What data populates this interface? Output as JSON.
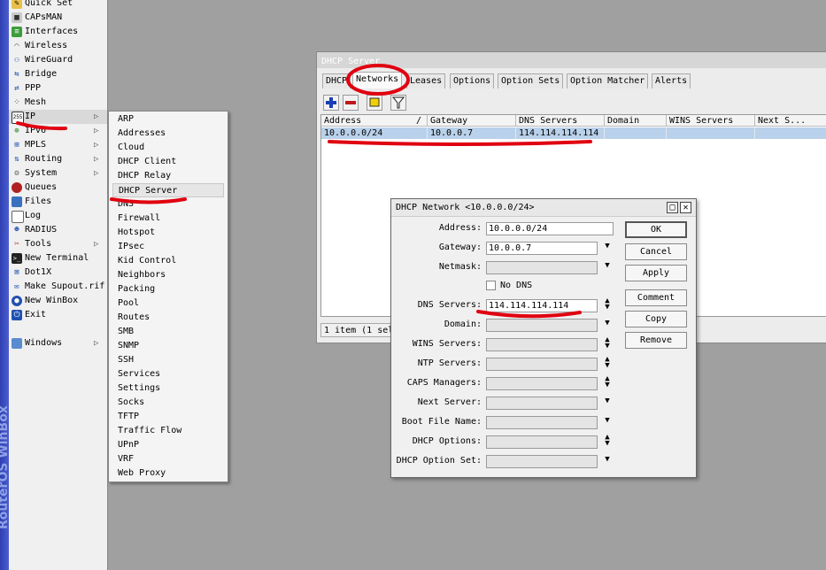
{
  "brand": "RouterOS WinBox",
  "main_menu": {
    "items": [
      {
        "label": "Quick Set",
        "icon": "quick-set-icon"
      },
      {
        "label": "CAPsMAN",
        "icon": "capsman-icon"
      },
      {
        "label": "Interfaces",
        "icon": "interfaces-icon"
      },
      {
        "label": "Wireless",
        "icon": "wireless-icon"
      },
      {
        "label": "WireGuard",
        "icon": "wireguard-icon"
      },
      {
        "label": "Bridge",
        "icon": "bridge-icon"
      },
      {
        "label": "PPP",
        "icon": "ppp-icon"
      },
      {
        "label": "Mesh",
        "icon": "mesh-icon"
      },
      {
        "label": "IP",
        "icon": "ip-icon",
        "has_submenu": true
      },
      {
        "label": "IPv6",
        "icon": "ipv6-icon",
        "has_submenu": true
      },
      {
        "label": "MPLS",
        "icon": "mpls-icon",
        "has_submenu": true
      },
      {
        "label": "Routing",
        "icon": "routing-icon",
        "has_submenu": true
      },
      {
        "label": "System",
        "icon": "system-icon",
        "has_submenu": true
      },
      {
        "label": "Queues",
        "icon": "queues-icon"
      },
      {
        "label": "Files",
        "icon": "files-icon"
      },
      {
        "label": "Log",
        "icon": "log-icon"
      },
      {
        "label": "RADIUS",
        "icon": "radius-icon"
      },
      {
        "label": "Tools",
        "icon": "tools-icon",
        "has_submenu": true
      },
      {
        "label": "New Terminal",
        "icon": "terminal-icon"
      },
      {
        "label": "Dot1X",
        "icon": "dot1x-icon"
      },
      {
        "label": "Make Supout.rif",
        "icon": "supout-icon"
      },
      {
        "label": "New WinBox",
        "icon": "winbox-icon"
      },
      {
        "label": "Exit",
        "icon": "exit-icon"
      },
      {
        "label": "Windows",
        "icon": "windows-icon",
        "has_submenu": true
      }
    ]
  },
  "ip_submenu": {
    "items": [
      "ARP",
      "Addresses",
      "Cloud",
      "DHCP Client",
      "DHCP Relay",
      "DHCP Server",
      "DNS",
      "Firewall",
      "Hotspot",
      "IPsec",
      "Kid Control",
      "Neighbors",
      "Packing",
      "Pool",
      "Routes",
      "SMB",
      "SNMP",
      "SSH",
      "Services",
      "Settings",
      "Socks",
      "TFTP",
      "Traffic Flow",
      "UPnP",
      "VRF",
      "Web Proxy"
    ],
    "selected": "DHCP Server"
  },
  "dhcp_window": {
    "title": "DHCP Server",
    "tabs": [
      "DHCP",
      "Networks",
      "Leases",
      "Options",
      "Option Sets",
      "Option Matcher",
      "Alerts"
    ],
    "active_tab": "Networks",
    "toolbar": [
      "add-icon",
      "remove-icon",
      "comment-icon",
      "filter-icon"
    ],
    "columns": [
      "Address",
      "Gateway",
      "DNS Servers",
      "Domain",
      "WINS Servers",
      "Next S..."
    ],
    "sort_indicator": "/",
    "rows": [
      {
        "address": "10.0.0.0/24",
        "gateway": "10.0.0.7",
        "dns": "114.114.114.114",
        "domain": "",
        "wins": "",
        "next": ""
      }
    ],
    "status": "1 item (1 sel"
  },
  "net_dialog": {
    "title": "DHCP Network <10.0.0.0/24>",
    "fields": {
      "address": {
        "label": "Address:",
        "value": "10.0.0.0/24"
      },
      "gateway": {
        "label": "Gateway:",
        "value": "10.0.0.7"
      },
      "netmask": {
        "label": "Netmask:",
        "value": ""
      },
      "no_dns": {
        "label": "No DNS",
        "checked": false
      },
      "dns": {
        "label": "DNS Servers:",
        "value": "114.114.114.114"
      },
      "domain": {
        "label": "Domain:",
        "value": ""
      },
      "wins": {
        "label": "WINS Servers:",
        "value": ""
      },
      "ntp": {
        "label": "NTP Servers:",
        "value": ""
      },
      "caps": {
        "label": "CAPS Managers:",
        "value": ""
      },
      "next_server": {
        "label": "Next Server:",
        "value": ""
      },
      "boot_file": {
        "label": "Boot File Name:",
        "value": ""
      },
      "dhcp_options": {
        "label": "DHCP Options:",
        "value": ""
      },
      "dhcp_option_set": {
        "label": "DHCP Option Set:",
        "value": ""
      }
    },
    "buttons": {
      "ok": "OK",
      "cancel": "Cancel",
      "apply": "Apply",
      "comment": "Comment",
      "copy": "Copy",
      "remove": "Remove"
    },
    "window_buttons": {
      "restore": "□",
      "close": "✕"
    }
  },
  "colors": {
    "annotation": "#e00010",
    "selected_row": "#b9d1ea",
    "brand_strip": "#2f3fb0"
  }
}
